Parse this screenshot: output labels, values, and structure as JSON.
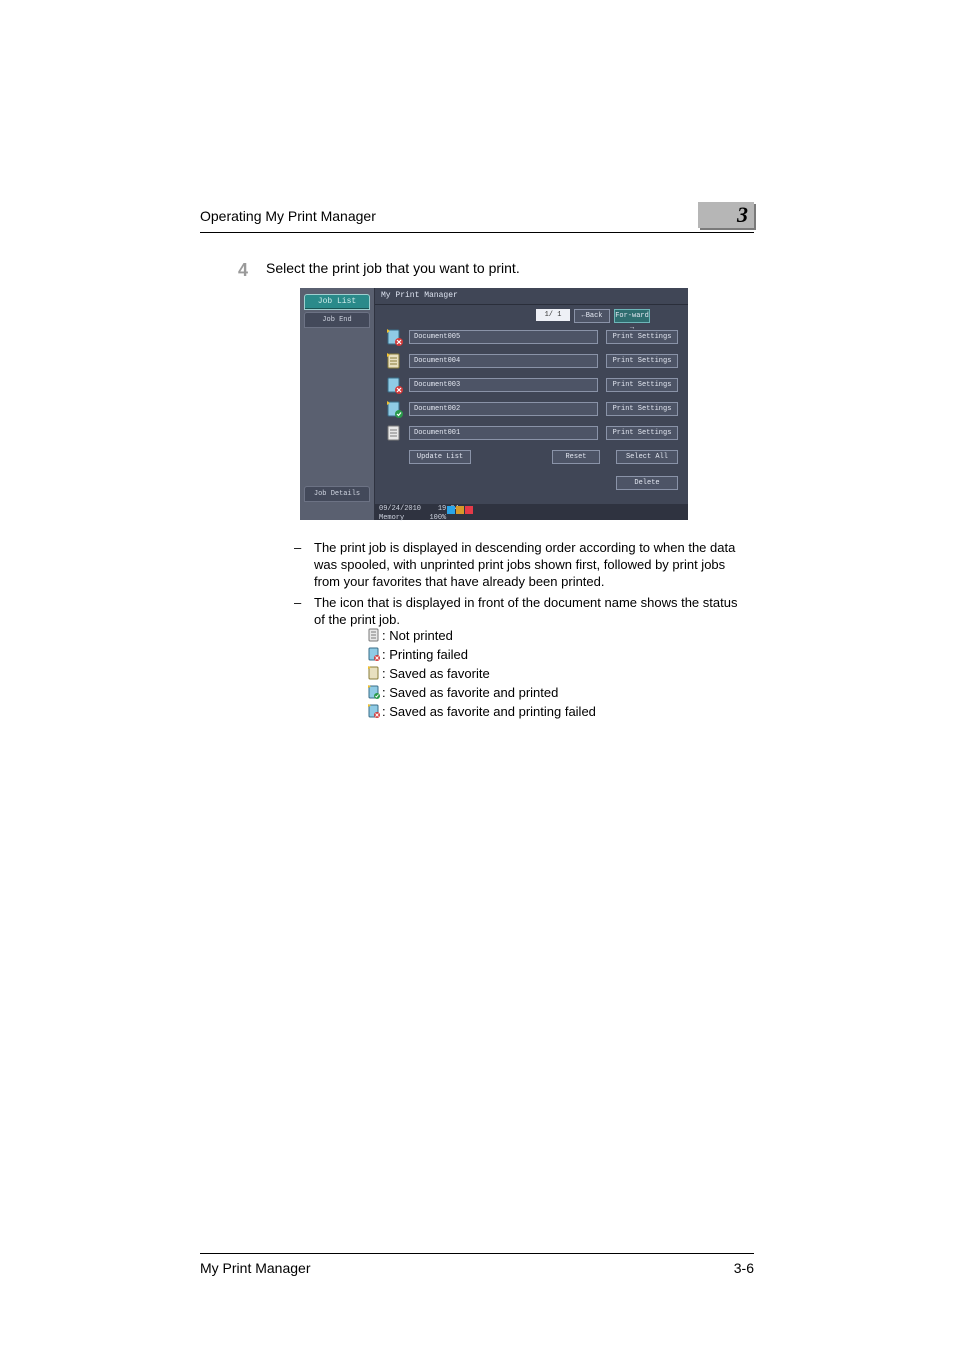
{
  "header": {
    "running_title": "Operating My Print Manager",
    "chapter_number": "3"
  },
  "step": {
    "number": "4",
    "text": "Select the print job that you want to print."
  },
  "screenshot": {
    "app_title": "My Print Manager",
    "left_tabs": {
      "job_list": "Job List",
      "job_end": "Job End"
    },
    "job_details_tab": "Job Details",
    "page_indicator": "1/ 1",
    "back_label": "Back",
    "forward_label": "For-ward",
    "documents": [
      {
        "name": "Document005",
        "ps": "Print Settings",
        "status": "fav_fail"
      },
      {
        "name": "Document004",
        "ps": "Print Settings",
        "status": "fav"
      },
      {
        "name": "Document003",
        "ps": "Print Settings",
        "status": "fail"
      },
      {
        "name": "Document002",
        "ps": "Print Settings",
        "status": "fav_printed"
      },
      {
        "name": "Document001",
        "ps": "Print Settings",
        "status": "not_printed"
      }
    ],
    "buttons": {
      "update_list": "Update List",
      "reset": "Reset",
      "select_all": "Select All",
      "delete": "Delete"
    },
    "status": {
      "date": "09/24/2010",
      "time": "19:04",
      "mem_label": "Memory",
      "mem_value": "100%"
    }
  },
  "notes": {
    "bullet1": "The print job is displayed in descending order according to when the data was spooled, with unprinted print jobs shown first, followed by print jobs from your favorites that have already been printed.",
    "bullet2": "The icon that is displayed in front of the document name shows the status of the print job.",
    "legend": {
      "not_printed": ": Not printed",
      "printing_failed": ": Printing failed",
      "saved_fav": ": Saved as favorite",
      "saved_fav_printed": ": Saved as favorite and printed",
      "saved_fav_failed": ": Saved as favorite and printing failed"
    }
  },
  "footer": {
    "product": "My Print Manager",
    "page": "3-6"
  }
}
